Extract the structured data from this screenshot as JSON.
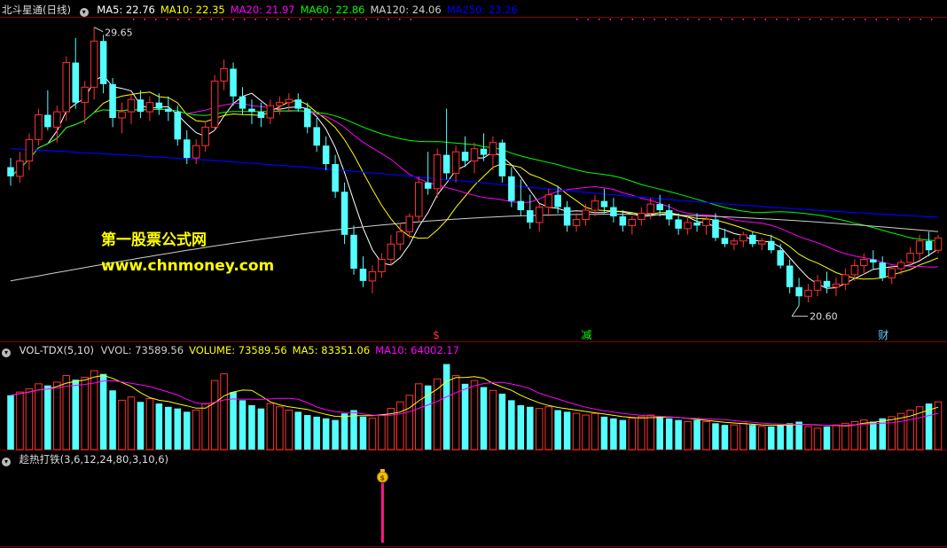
{
  "main_panel": {
    "title": "北斗星通(日线)",
    "indicators": [
      {
        "label": "MA5: 22.76",
        "color": "#ffffff"
      },
      {
        "label": "MA10: 22.35",
        "color": "#ffff00"
      },
      {
        "label": "MA20: 21.97",
        "color": "#ff00ff"
      },
      {
        "label": "MA60: 22.86",
        "color": "#00ff00"
      },
      {
        "label": "MA120: 24.06",
        "color": "#d0d0d0"
      },
      {
        "label": "MA250: 23.26",
        "color": "#0000ff"
      }
    ],
    "high_label": "29.65",
    "low_label": "20.60",
    "event_markers": [
      {
        "text": "$",
        "color": "#ff3030"
      },
      {
        "text": "减",
        "color": "#00ff00"
      },
      {
        "text": "财",
        "color": "#66ccff"
      }
    ],
    "watermark_name": "第一股票公式网",
    "watermark_url": "www.chnmoney.com"
  },
  "volume_panel": {
    "title": "VOL-TDX(5,10)",
    "indicators": [
      {
        "label": "VVOL: 73589.56",
        "color": "#cccccc"
      },
      {
        "label": "VOLUME: 73589.56",
        "color": "#ffff00"
      },
      {
        "label": "MA5: 83351.06",
        "color": "#ffff00"
      },
      {
        "label": "MA10: 64002.17",
        "color": "#ff00ff"
      }
    ]
  },
  "signal_panel": {
    "title": "趁热打铁(3,6,12,24,80,3,10,6)",
    "signal_icon": "money-bag-icon",
    "signal_symbol": "$"
  },
  "colors": {
    "up": "#ff3232",
    "down": "#54ffff",
    "grid": "#800000",
    "signal": "#ff1a8c"
  },
  "chart_data": {
    "type": "candlestick",
    "price_range": [
      20.6,
      29.65
    ],
    "ohlc": [
      [
        25.1,
        25.4,
        24.5,
        24.8
      ],
      [
        24.8,
        25.6,
        24.6,
        25.3
      ],
      [
        25.3,
        26.2,
        25.0,
        26.0
      ],
      [
        26.0,
        27.0,
        25.8,
        26.8
      ],
      [
        26.8,
        27.6,
        26.3,
        26.4
      ],
      [
        26.4,
        27.1,
        25.9,
        26.9
      ],
      [
        26.9,
        28.7,
        26.6,
        28.5
      ],
      [
        28.5,
        29.3,
        27.0,
        27.2
      ],
      [
        27.2,
        27.9,
        26.5,
        27.7
      ],
      [
        27.7,
        29.65,
        27.3,
        29.2
      ],
      [
        29.2,
        29.4,
        27.5,
        27.8
      ],
      [
        27.8,
        28.0,
        26.4,
        26.7
      ],
      [
        26.7,
        27.2,
        26.2,
        26.9
      ],
      [
        26.9,
        27.5,
        26.5,
        27.3
      ],
      [
        27.3,
        27.6,
        26.7,
        26.9
      ],
      [
        26.9,
        27.4,
        26.6,
        27.2
      ],
      [
        27.2,
        27.5,
        26.8,
        27.0
      ],
      [
        27.0,
        27.4,
        26.6,
        26.9
      ],
      [
        26.9,
        27.1,
        25.8,
        26.0
      ],
      [
        26.0,
        26.3,
        25.2,
        25.4
      ],
      [
        25.4,
        26.0,
        25.2,
        25.8
      ],
      [
        25.8,
        26.6,
        25.6,
        26.4
      ],
      [
        26.4,
        28.1,
        26.3,
        27.9
      ],
      [
        27.9,
        28.6,
        27.6,
        28.3
      ],
      [
        28.3,
        28.5,
        27.1,
        27.4
      ],
      [
        27.4,
        27.7,
        26.8,
        27.0
      ],
      [
        27.0,
        27.3,
        26.5,
        26.9
      ],
      [
        26.9,
        27.2,
        26.4,
        26.7
      ],
      [
        26.7,
        27.3,
        26.5,
        27.1
      ],
      [
        27.1,
        27.4,
        26.8,
        27.2
      ],
      [
        27.2,
        27.5,
        26.9,
        27.3
      ],
      [
        27.3,
        27.5,
        26.9,
        27.0
      ],
      [
        27.0,
        27.2,
        26.2,
        26.4
      ],
      [
        26.4,
        26.7,
        25.6,
        25.8
      ],
      [
        25.8,
        26.1,
        25.0,
        25.2
      ],
      [
        25.2,
        25.5,
        24.1,
        24.3
      ],
      [
        24.3,
        24.6,
        22.6,
        22.9
      ],
      [
        22.9,
        23.2,
        21.6,
        21.8
      ],
      [
        21.8,
        22.2,
        21.2,
        21.4
      ],
      [
        21.4,
        21.9,
        21.0,
        21.7
      ],
      [
        21.7,
        22.3,
        21.5,
        22.1
      ],
      [
        22.1,
        22.9,
        21.9,
        22.6
      ],
      [
        22.6,
        23.3,
        22.4,
        23.0
      ],
      [
        23.0,
        23.6,
        22.8,
        23.5
      ],
      [
        23.5,
        24.8,
        23.3,
        24.6
      ],
      [
        24.6,
        25.6,
        24.2,
        24.4
      ],
      [
        24.4,
        25.7,
        24.1,
        25.5
      ],
      [
        25.5,
        27.0,
        24.7,
        24.9
      ],
      [
        24.9,
        25.8,
        24.6,
        25.6
      ],
      [
        25.6,
        26.1,
        25.1,
        25.3
      ],
      [
        25.3,
        25.9,
        24.9,
        25.7
      ],
      [
        25.7,
        26.2,
        25.3,
        25.5
      ],
      [
        25.5,
        26.1,
        25.0,
        25.9
      ],
      [
        25.9,
        26.0,
        24.6,
        24.8
      ],
      [
        24.8,
        25.1,
        23.8,
        24.0
      ],
      [
        24.0,
        24.7,
        23.5,
        23.7
      ],
      [
        23.7,
        24.2,
        23.1,
        23.3
      ],
      [
        23.3,
        23.9,
        23.0,
        23.8
      ],
      [
        23.8,
        24.4,
        23.5,
        24.2
      ],
      [
        24.2,
        24.5,
        23.6,
        23.8
      ],
      [
        23.8,
        24.0,
        23.0,
        23.2
      ],
      [
        23.2,
        23.6,
        23.0,
        23.4
      ],
      [
        23.4,
        23.9,
        23.2,
        23.7
      ],
      [
        23.7,
        24.2,
        23.5,
        24.0
      ],
      [
        24.0,
        24.4,
        23.6,
        23.8
      ],
      [
        23.8,
        24.1,
        23.3,
        23.5
      ],
      [
        23.5,
        23.7,
        23.0,
        23.2
      ],
      [
        23.2,
        23.5,
        22.9,
        23.4
      ],
      [
        23.4,
        23.8,
        23.2,
        23.6
      ],
      [
        23.6,
        24.1,
        23.4,
        23.9
      ],
      [
        23.9,
        24.2,
        23.5,
        23.7
      ],
      [
        23.7,
        23.9,
        23.2,
        23.4
      ],
      [
        23.4,
        23.6,
        22.9,
        23.1
      ],
      [
        23.1,
        23.5,
        22.9,
        23.3
      ],
      [
        23.3,
        23.6,
        23.0,
        23.2
      ],
      [
        23.2,
        23.5,
        22.9,
        23.4
      ],
      [
        23.4,
        23.6,
        22.7,
        22.8
      ],
      [
        22.8,
        23.1,
        22.5,
        22.6
      ],
      [
        22.6,
        22.8,
        22.4,
        22.7
      ],
      [
        22.7,
        23.0,
        22.5,
        22.9
      ],
      [
        22.9,
        23.0,
        22.5,
        22.6
      ],
      [
        22.6,
        22.8,
        22.4,
        22.7
      ],
      [
        22.7,
        22.9,
        22.3,
        22.4
      ],
      [
        22.4,
        22.6,
        21.8,
        21.9
      ],
      [
        21.9,
        22.1,
        21.0,
        21.2
      ],
      [
        21.2,
        21.5,
        20.6,
        20.9
      ],
      [
        20.9,
        21.3,
        20.7,
        21.1
      ],
      [
        21.1,
        21.6,
        20.9,
        21.4
      ],
      [
        21.4,
        21.7,
        21.0,
        21.2
      ],
      [
        21.2,
        21.5,
        20.9,
        21.3
      ],
      [
        21.3,
        21.8,
        21.1,
        21.6
      ],
      [
        21.6,
        22.1,
        21.4,
        21.9
      ],
      [
        21.9,
        22.3,
        21.6,
        22.1
      ],
      [
        22.1,
        22.4,
        21.8,
        22.0
      ],
      [
        22.0,
        22.2,
        21.4,
        21.5
      ],
      [
        21.5,
        21.9,
        21.3,
        21.8
      ],
      [
        21.8,
        22.1,
        21.6,
        22.0
      ],
      [
        22.0,
        22.5,
        21.9,
        22.3
      ],
      [
        22.3,
        22.9,
        22.1,
        22.7
      ],
      [
        22.7,
        23.0,
        22.2,
        22.4
      ],
      [
        22.4,
        22.9,
        22.3,
        22.8
      ]
    ],
    "volume": [
      66,
      70,
      74,
      80,
      78,
      82,
      90,
      85,
      88,
      96,
      92,
      72,
      60,
      64,
      58,
      62,
      56,
      52,
      50,
      46,
      48,
      56,
      84,
      92,
      70,
      60,
      54,
      50,
      56,
      52,
      48,
      46,
      42,
      40,
      38,
      36,
      44,
      48,
      40,
      38,
      42,
      50,
      58,
      66,
      80,
      78,
      86,
      104,
      90,
      80,
      84,
      76,
      72,
      68,
      60,
      54,
      52,
      50,
      52,
      48,
      46,
      44,
      42,
      44,
      40,
      38,
      36,
      38,
      40,
      42,
      40,
      38,
      36,
      34,
      36,
      34,
      32,
      30,
      30,
      32,
      30,
      28,
      28,
      30,
      32,
      34,
      28,
      26,
      28,
      30,
      32,
      34,
      36,
      34,
      38,
      40,
      44,
      48,
      52,
      56,
      58
    ],
    "ma": {
      "MA5": 22.76,
      "MA10": 22.35,
      "MA20": 21.97,
      "MA60": 22.86,
      "MA120": 24.06,
      "MA250": 23.26
    },
    "volume_ma": {
      "VVOL": 73589.56,
      "MA5": 83351.06,
      "MA10": 64002.17
    }
  }
}
